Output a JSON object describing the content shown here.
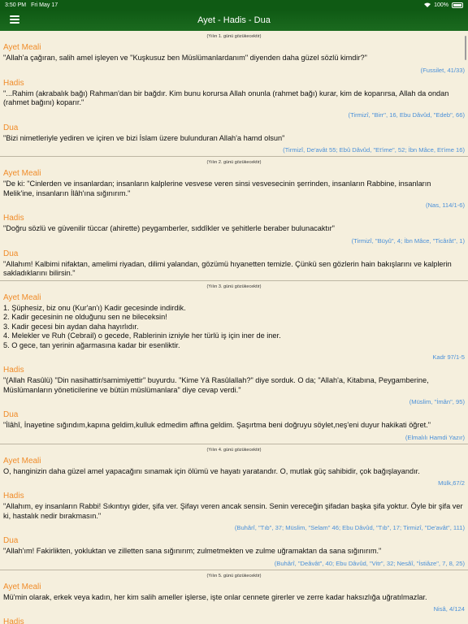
{
  "statusbar": {
    "time": "3:50 PM",
    "date": "Fri May 17",
    "battery": "100%"
  },
  "navbar": {
    "title": "Ayet - Hadis - Dua"
  },
  "colors": {
    "nav_bg": "#0f5a14",
    "section_title": "#f08c2a",
    "source": "#4a90d9",
    "page_bg": "#f5efdd"
  },
  "days": [
    {
      "label": "(Yılın 1. günü gözükecektir)",
      "sections": [
        {
          "title": "Ayet Meali",
          "text": "\"Allah'a çağıran, salih amel işleyen ve \"Kuşkusuz ben Müslümanlardanım\" diyenden daha güzel sözlü kimdir?\"",
          "source": "(Fussilet, 41/33)"
        },
        {
          "title": "Hadis",
          "text": "\"...Rahim (akrabalık bağı) Rahman'dan bir bağdır. Kim bunu korursa Allah onunla (rahmet bağı) kurar, kim de koparırsa, Allah da ondan (rahmet bağını) koparır.\"",
          "source": "(Tirmizî, \"Birr\", 16, Ebu Dâvûd, \"Edeb\", 66)"
        },
        {
          "title": "Dua",
          "text": "\"Bizi nimetleriyle yediren ve içiren ve bizi İslam üzere bulunduran Allah'a hamd olsun\"",
          "source": "(Tirmizî, De'avât 55; Ebû Dâvûd, \"Et'ime\", 52; İbn Mâce, Et'ime 16)"
        }
      ]
    },
    {
      "label": "(Yılın 2. günü gözükecektir)",
      "sections": [
        {
          "title": "Ayet Meali",
          "text": "\"De ki: \"Cinlerden ve insanlardan; insanların kalplerine vesvese veren sinsi vesvesecinin şerrinden, insanların Rabbine, insanların Melik'ine, insanların İlâh'ına sığınırım.\"",
          "source": "(Nas, 114/1-6)"
        },
        {
          "title": "Hadis",
          "text": "\"Doğru sözlü ve güvenilir tüccar (ahirette) peygamberler, sıddîkler ve şehitlerle beraber bulunacaktır\"",
          "source": "(Tirmizî, \"Büyû\", 4; İbn Mâce, \"Ticârât\", 1)"
        },
        {
          "title": "Dua",
          "text": "\"Allahım! Kalbimi nifaktan, amelimi riyadan, dilimi yalandan, gözümü hıyanetten temizle. Çünkü sen gözlerin hain bakışlarını ve kalplerin sakladıklarını bilirsin.\"",
          "source": ""
        }
      ]
    },
    {
      "label": "(Yılın 3. günü gözükecektir)",
      "sections": [
        {
          "title": "Ayet Meali",
          "lines": [
            "1. Şüphesiz, biz onu (Kur'an'ı) Kadir gecesinde indirdik.",
            "2. Kadir gecesinin ne olduğunu sen ne bileceksin!",
            "3. Kadir gecesi bin aydan daha hayırlıdır.",
            "4. Melekler ve Ruh (Cebrail) o gecede, Rablerinin izniyle her türlü iş için iner de iner.",
            "5. O gece, tan yerinin ağarmasına kadar bir esenliktir."
          ],
          "source": "Kadr 97/1-5"
        },
        {
          "title": "Hadis",
          "text": "\"(Allah Rasûlü) \"Din nasihattir/samimiyettir\" buyurdu. \"Kime Yâ Rasûlallah?\" diye sorduk. O da; \"Allah'a, Kitabına, Peygamberine, Müslümanların yöneticilerine ve bütün müslümanlara\" diye cevap verdi.\"",
          "source": "(Müslim, \"İmân\", 95)"
        },
        {
          "title": "Dua",
          "text": "\"İlâhî, İnayetine sığındım,kapına geldim,kulluk edmedim affına geldim. Şaşırtma beni doğruyu söylet,neş'eni duyur hakikati öğret.\"",
          "source": "(Elmalılı Hamdi Yazır)"
        }
      ]
    },
    {
      "label": "(Yılın 4. günü gözükecektir)",
      "sections": [
        {
          "title": "Ayet Meali",
          "text": "O, hanginizin daha güzel amel yapacağını sınamak için ölümü ve hayatı yaratandır. O, mutlak güç sahibidir, çok bağışlayandır.",
          "source": "Mülk,67/2"
        },
        {
          "title": "Hadis",
          "text": "\"Allahım, ey insanların Rabbi! Sıkıntıyı gider, şifa ver. Şifayı veren ancak sensin. Senin vereceğin şifadan başka şifa yoktur. Öyle bir şifa ver ki, hastalık nedir bırakmasın.\"",
          "source": "(Buhârî, \"Tıb\", 37; Müslim, \"Selam\" 46; Ebu Dâvûd, \"Tıb\", 17; Tirmizî, \"De'avât\", 111)"
        },
        {
          "title": "Dua",
          "text": "\"Allah'ım! Fakirlikten, yokluktan ve zilletten sana sığınırım; zulmetmekten ve zulme uğramaktan da sana sığınırım.\"",
          "source": "(Buhârî, \"Deâvât\", 40; Ebu Dâvûd, \"Vitr\", 32; Nesâî, \"İstiâze\", 7, 8, 25)"
        }
      ]
    },
    {
      "label": "(Yılın 5. günü gözükecektir)",
      "sections": [
        {
          "title": "Ayet Meali",
          "text": "Mü'min olarak, erkek veya kadın, her kim salih ameller işlerse, işte onlar cennete girerler ve zerre kadar haksızlığa uğratılmazlar.",
          "source": "Nisâ, 4/124"
        },
        {
          "title": "Hadis",
          "text": "",
          "source": ""
        }
      ]
    }
  ]
}
